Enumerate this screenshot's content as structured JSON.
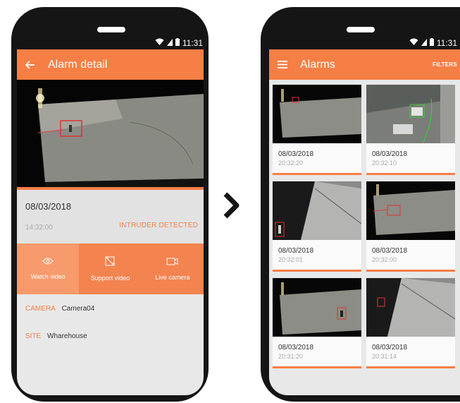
{
  "status_bar": {
    "time": "11:31"
  },
  "detail": {
    "appbar": {
      "title": "Alarm detail",
      "back_icon": "back-arrow-icon"
    },
    "alarm": {
      "date": "08/03/2018",
      "time": "14:32:00",
      "status": "INTRUDER DETECTED"
    },
    "actions": [
      {
        "label": "Watch video",
        "icon": "eye-icon"
      },
      {
        "label": "Support video",
        "icon": "support-video-icon"
      },
      {
        "label": "Live camera",
        "icon": "video-camera-icon"
      }
    ],
    "camera": {
      "key": "CAMERA",
      "value": "Camera04"
    },
    "site": {
      "key": "SITE",
      "value": "Wharehouse"
    }
  },
  "alarms": {
    "appbar": {
      "title": "Alarms",
      "filters_label": "FILTERS",
      "menu_icon": "hamburger-menu-icon"
    },
    "items": [
      {
        "date": "08/03/2018",
        "time": "20:32:20"
      },
      {
        "date": "08/03/2018",
        "time": "20:32:10"
      },
      {
        "date": "08/03/2018",
        "time": "20:32:01"
      },
      {
        "date": "08/03/2018",
        "time": "20:32:00"
      },
      {
        "date": "08/03/2018",
        "time": "20:31:20"
      },
      {
        "date": "08/03/2018",
        "time": "20:31:14"
      }
    ]
  },
  "colors": {
    "accent": "#f57f45",
    "accent_light": "#f79a6c",
    "accent_dark": "#f3834f",
    "device": "#151515",
    "screen_bg": "#e8e8e8"
  }
}
